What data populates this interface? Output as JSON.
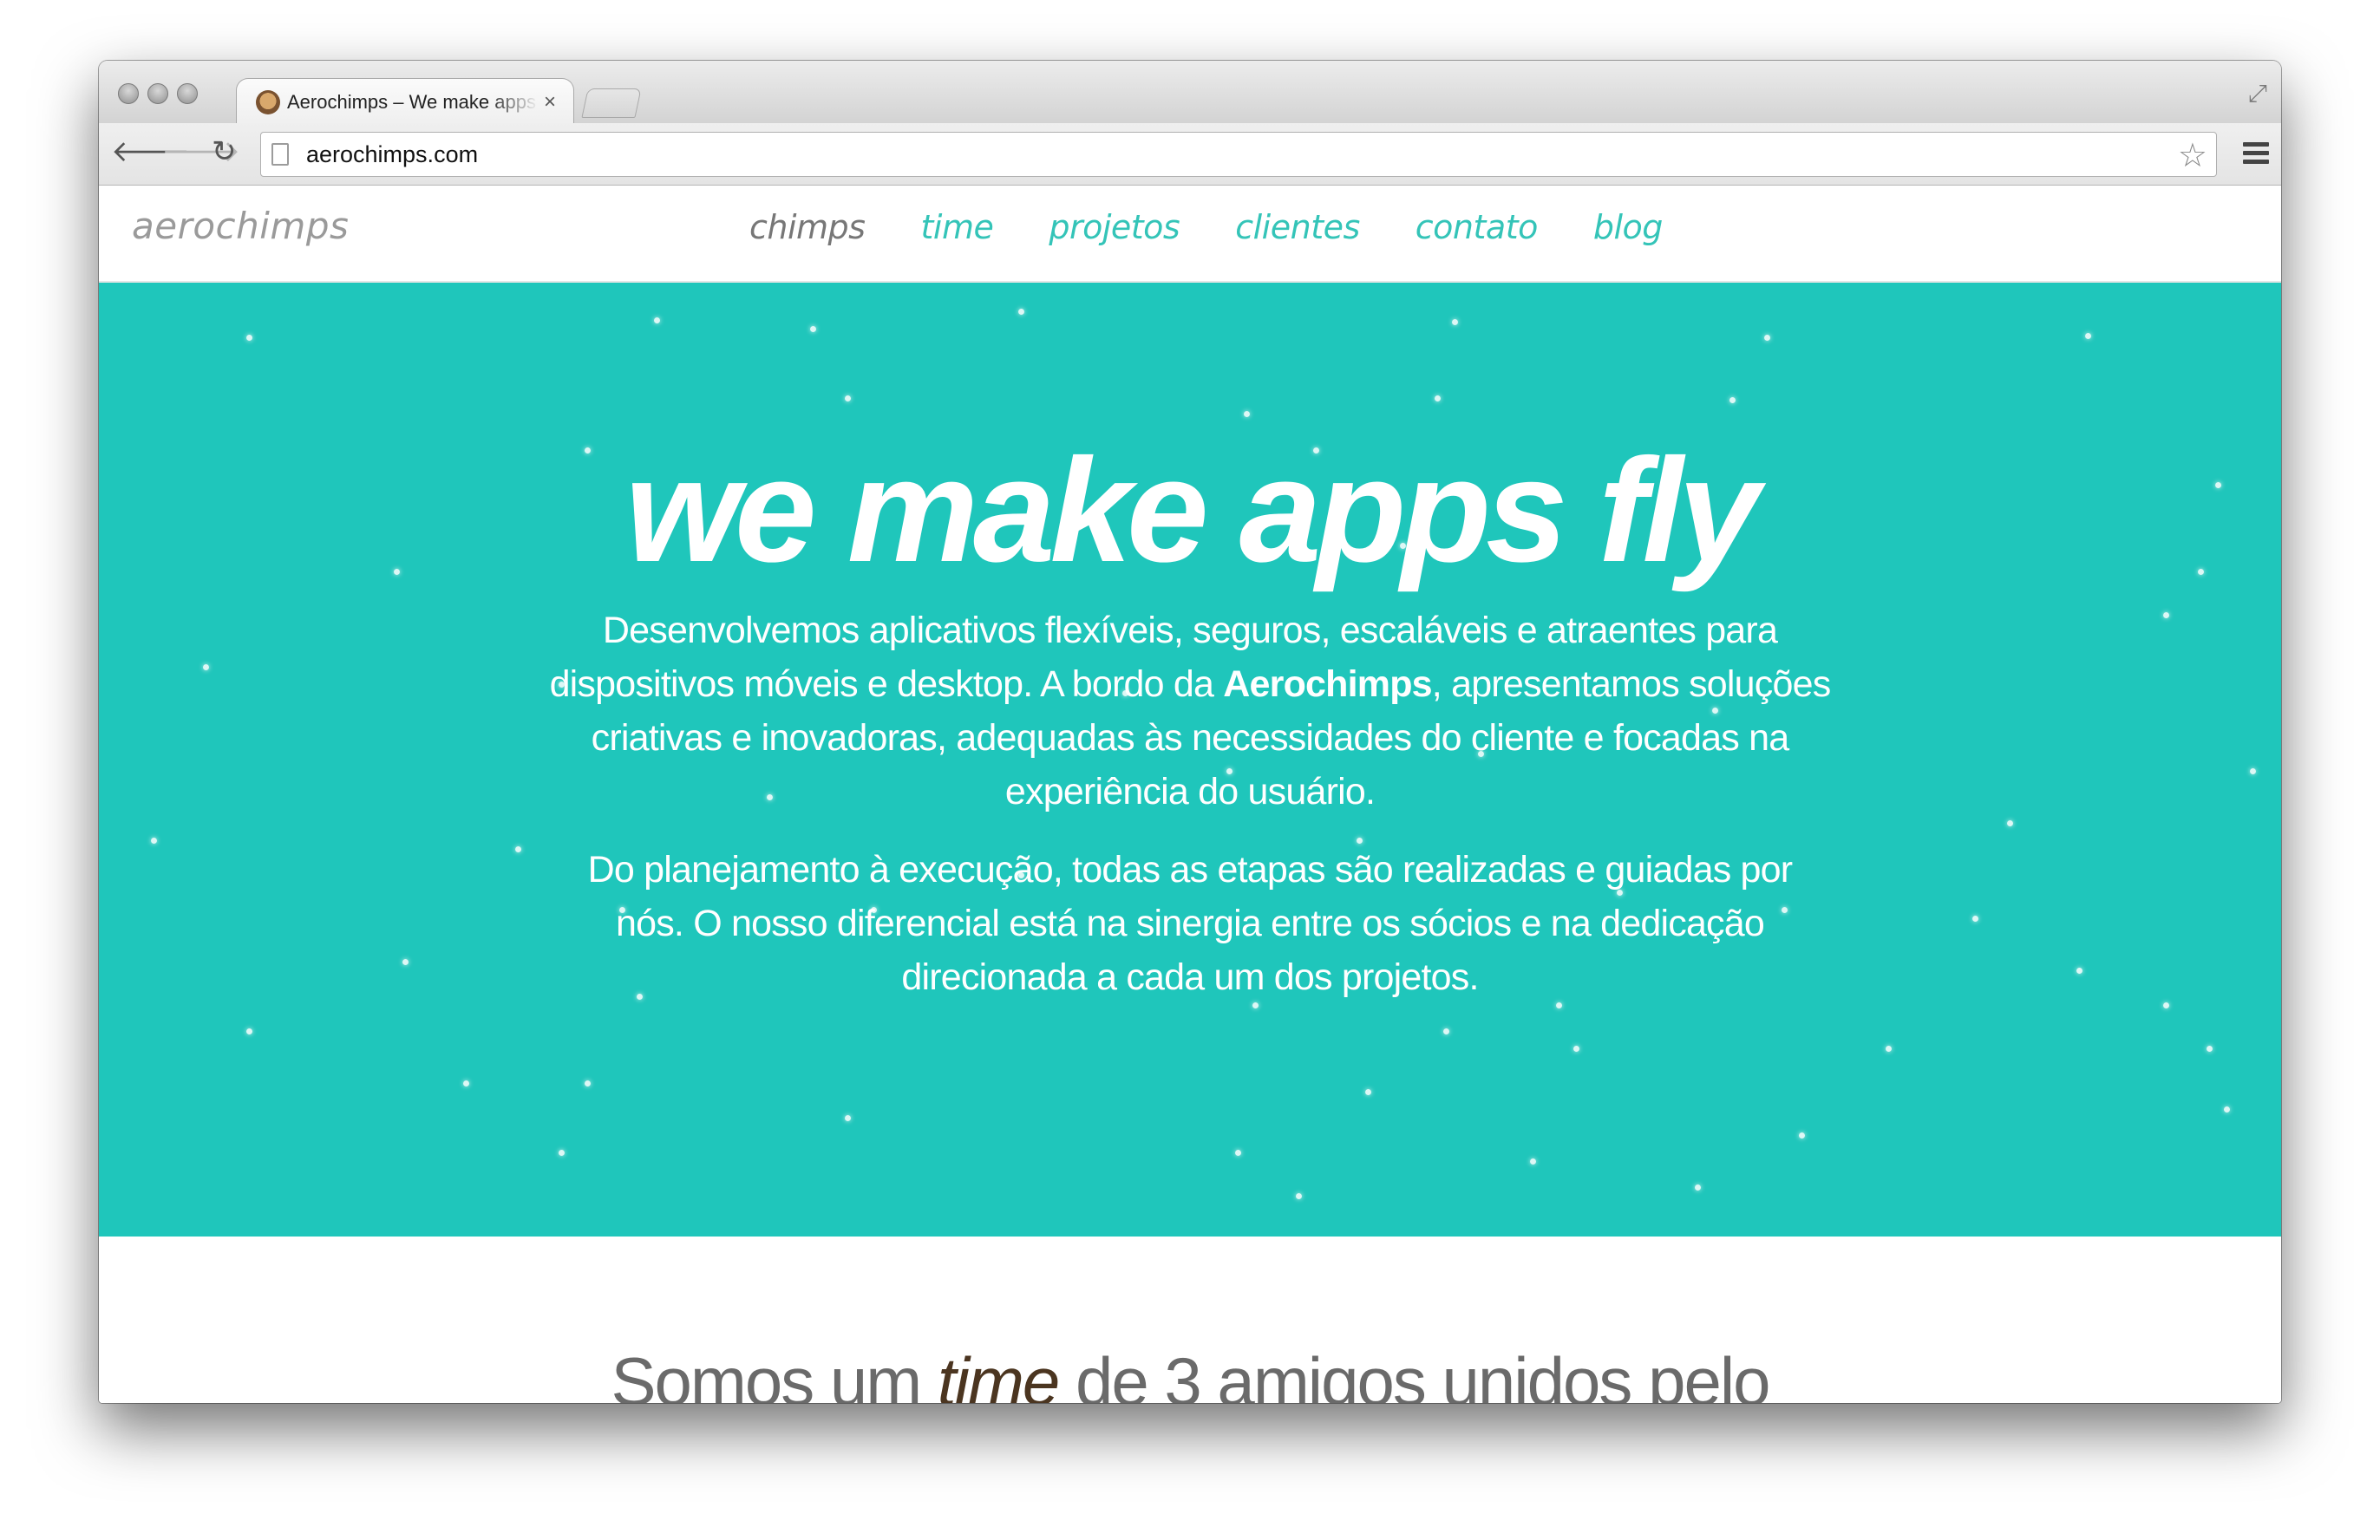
{
  "browser": {
    "tab_title": "Aerochimps – We make apps fly",
    "tab_close": "×",
    "url": "aerochimps.com"
  },
  "site": {
    "logo": "aerochimps",
    "nav": [
      "chimps",
      "time",
      "projetos",
      "clientes",
      "contato",
      "blog"
    ],
    "active_nav": "chimps"
  },
  "hero": {
    "headline": "we make apps fly",
    "p1_before": "Desenvolvemos aplicativos flexíveis, seguros, escaláveis e atraentes para dispositivos móveis e desktop. A bordo da ",
    "p1_bold": "Aerochimps",
    "p1_after": ", apresentamos soluções criativas e inovadoras, adequadas às necessidades do cliente e focadas na experiência do usuário.",
    "p2": "Do planejamento à execução, todas as etapas são realizadas e guiadas por nós. O nosso diferencial está na sinergia entre os sócios e na dedicação direcionada a cada um dos projetos."
  },
  "team": {
    "before": "Somos um ",
    "em": "time",
    "after": " de 3 amigos unidos pelo"
  },
  "colors": {
    "accent": "#1fc6bb",
    "nav_link": "#34c4b8",
    "nav_active": "#777777"
  },
  "icons": [
    "back-arrow-icon",
    "forward-arrow-icon",
    "reload-icon",
    "page-icon",
    "star-icon",
    "menu-icon",
    "fullscreen-icon",
    "favicon-icon"
  ]
}
